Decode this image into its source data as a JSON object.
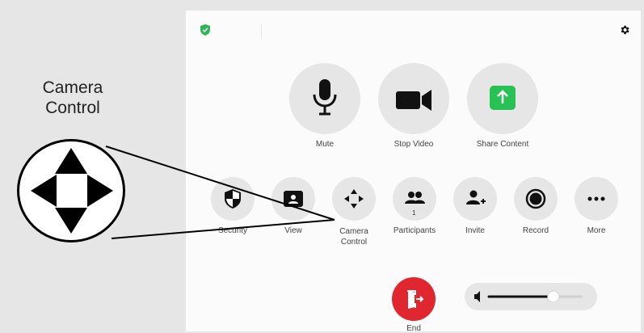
{
  "callout": {
    "label": "Camera\nControl"
  },
  "main_buttons": [
    {
      "label": "Mute",
      "icon": "microphone-icon"
    },
    {
      "label": "Stop Video",
      "icon": "video-camera-icon"
    },
    {
      "label": "Share Content",
      "icon": "share-arrow-icon"
    }
  ],
  "toolbar": [
    {
      "label": "Security",
      "icon": "shield-icon"
    },
    {
      "label": "View",
      "icon": "view-icon"
    },
    {
      "label": "Camera\nControl",
      "icon": "directional-arrows-icon"
    },
    {
      "label": "Participants",
      "icon": "participants-icon",
      "count": "1"
    },
    {
      "label": "Invite",
      "icon": "add-person-icon"
    },
    {
      "label": "Record",
      "icon": "record-icon"
    },
    {
      "label": "More",
      "icon": "ellipsis-icon"
    }
  ],
  "end": {
    "label": "End",
    "icon": "exit-door-icon"
  },
  "volume": {
    "level": 0.7,
    "icon": "speaker-icon"
  },
  "colors": {
    "share_green": "#27c253",
    "end_red": "#e0272f",
    "security_green": "#2fb555"
  }
}
